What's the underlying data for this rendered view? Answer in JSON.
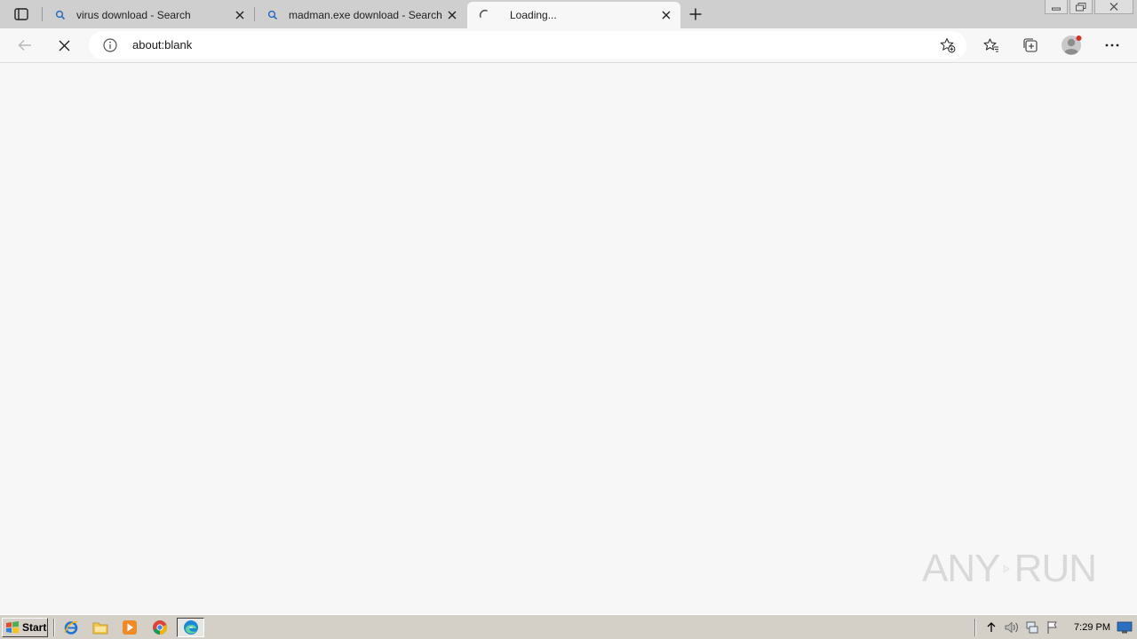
{
  "tabs": [
    {
      "title": "virus download - Search",
      "favicon": "search-icon",
      "state": "inactive"
    },
    {
      "title": "madman.exe download - Search",
      "favicon": "search-icon",
      "state": "inactive"
    },
    {
      "title": "Loading...",
      "favicon": "loading-spinner-icon",
      "state": "active"
    }
  ],
  "address_bar": {
    "url": "about:blank"
  },
  "watermark": {
    "left_text": "ANY",
    "right_text": "RUN"
  },
  "taskbar": {
    "start_label": "Start",
    "apps": [
      "internet-explorer-icon",
      "file-explorer-icon",
      "media-player-icon",
      "chrome-icon",
      "edge-icon"
    ],
    "clock": "7:29 PM"
  },
  "colors": {
    "accent_blue": "#1a73e8",
    "tab_strip_bg": "#cfcfcf",
    "page_bg": "#f7f7f7",
    "taskbar_bg": "#d4d0c8"
  }
}
